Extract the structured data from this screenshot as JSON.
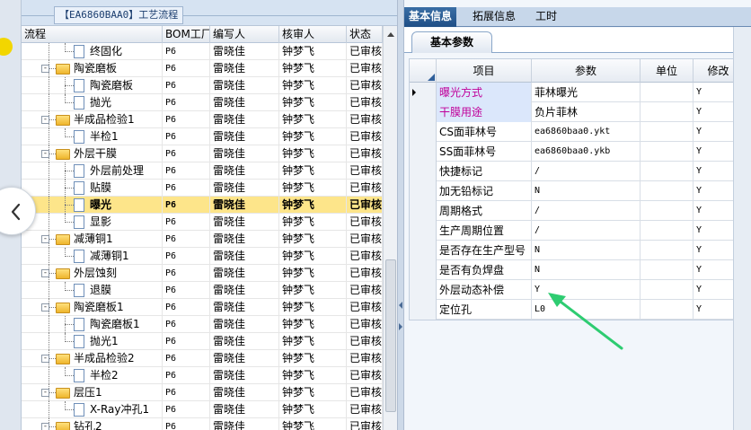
{
  "left_pane": {
    "title": "【EA6860BAA0】工艺流程",
    "columns": [
      "流程",
      "BOM工厂",
      "编写人",
      "核审人",
      "状态"
    ],
    "rows": [
      {
        "label": "终固化",
        "bom": "P6",
        "author": "雷晓佳",
        "reviewer": "钟梦飞",
        "status": "已审核",
        "level": 2,
        "type": "file",
        "selected": false
      },
      {
        "label": "陶瓷磨板",
        "bom": "P6",
        "author": "雷晓佳",
        "reviewer": "钟梦飞",
        "status": "已审核",
        "level": 1,
        "type": "folder",
        "selected": false
      },
      {
        "label": "陶瓷磨板",
        "bom": "P6",
        "author": "雷晓佳",
        "reviewer": "钟梦飞",
        "status": "已审核",
        "level": 2,
        "type": "file",
        "selected": false
      },
      {
        "label": "抛光",
        "bom": "P6",
        "author": "雷晓佳",
        "reviewer": "钟梦飞",
        "status": "已审核",
        "level": 2,
        "type": "file",
        "selected": false
      },
      {
        "label": "半成品检验1",
        "bom": "P6",
        "author": "雷晓佳",
        "reviewer": "钟梦飞",
        "status": "已审核",
        "level": 1,
        "type": "folder",
        "selected": false
      },
      {
        "label": "半检1",
        "bom": "P6",
        "author": "雷晓佳",
        "reviewer": "钟梦飞",
        "status": "已审核",
        "level": 2,
        "type": "file",
        "selected": false
      },
      {
        "label": "外层干膜",
        "bom": "P6",
        "author": "雷晓佳",
        "reviewer": "钟梦飞",
        "status": "已审核",
        "level": 1,
        "type": "folder",
        "selected": false
      },
      {
        "label": "外层前处理",
        "bom": "P6",
        "author": "雷晓佳",
        "reviewer": "钟梦飞",
        "status": "已审核",
        "level": 2,
        "type": "file",
        "selected": false
      },
      {
        "label": "贴膜",
        "bom": "P6",
        "author": "雷晓佳",
        "reviewer": "钟梦飞",
        "status": "已审核",
        "level": 2,
        "type": "file",
        "selected": false
      },
      {
        "label": "曝光",
        "bom": "P6",
        "author": "雷晓佳",
        "reviewer": "钟梦飞",
        "status": "已审核",
        "level": 2,
        "type": "file",
        "selected": true
      },
      {
        "label": "显影",
        "bom": "P6",
        "author": "雷晓佳",
        "reviewer": "钟梦飞",
        "status": "已审核",
        "level": 2,
        "type": "file",
        "selected": false
      },
      {
        "label": "减薄铜1",
        "bom": "P6",
        "author": "雷晓佳",
        "reviewer": "钟梦飞",
        "status": "已审核",
        "level": 1,
        "type": "folder",
        "selected": false
      },
      {
        "label": "减薄铜1",
        "bom": "P6",
        "author": "雷晓佳",
        "reviewer": "钟梦飞",
        "status": "已审核",
        "level": 2,
        "type": "file",
        "selected": false
      },
      {
        "label": "外层蚀刻",
        "bom": "P6",
        "author": "雷晓佳",
        "reviewer": "钟梦飞",
        "status": "已审核",
        "level": 1,
        "type": "folder",
        "selected": false
      },
      {
        "label": "退膜",
        "bom": "P6",
        "author": "雷晓佳",
        "reviewer": "钟梦飞",
        "status": "已审核",
        "level": 2,
        "type": "file",
        "selected": false
      },
      {
        "label": "陶瓷磨板1",
        "bom": "P6",
        "author": "雷晓佳",
        "reviewer": "钟梦飞",
        "status": "已审核",
        "level": 1,
        "type": "folder",
        "selected": false
      },
      {
        "label": "陶瓷磨板1",
        "bom": "P6",
        "author": "雷晓佳",
        "reviewer": "钟梦飞",
        "status": "已审核",
        "level": 2,
        "type": "file",
        "selected": false
      },
      {
        "label": "抛光1",
        "bom": "P6",
        "author": "雷晓佳",
        "reviewer": "钟梦飞",
        "status": "已审核",
        "level": 2,
        "type": "file",
        "selected": false
      },
      {
        "label": "半成品检验2",
        "bom": "P6",
        "author": "雷晓佳",
        "reviewer": "钟梦飞",
        "status": "已审核",
        "level": 1,
        "type": "folder",
        "selected": false
      },
      {
        "label": "半检2",
        "bom": "P6",
        "author": "雷晓佳",
        "reviewer": "钟梦飞",
        "status": "已审核",
        "level": 2,
        "type": "file",
        "selected": false
      },
      {
        "label": "层压1",
        "bom": "P6",
        "author": "雷晓佳",
        "reviewer": "钟梦飞",
        "status": "已审核",
        "level": 1,
        "type": "folder",
        "selected": false
      },
      {
        "label": "X-Ray冲孔1",
        "bom": "P6",
        "author": "雷晓佳",
        "reviewer": "钟梦飞",
        "status": "已审核",
        "level": 2,
        "type": "file",
        "selected": false
      },
      {
        "label": "钻孔2",
        "bom": "P6",
        "author": "雷晓佳",
        "reviewer": "钟梦飞",
        "status": "已审核",
        "level": 1,
        "type": "folder",
        "selected": false
      }
    ]
  },
  "right_pane": {
    "tabs": [
      {
        "label": "基本信息",
        "active": true
      },
      {
        "label": "拓展信息",
        "active": false
      },
      {
        "label": "工时",
        "active": false
      }
    ],
    "subtab": "基本参数",
    "columns": [
      "项目",
      "参数",
      "单位",
      "修改"
    ],
    "rows": [
      {
        "item": "曝光方式",
        "param": "菲林曝光",
        "unit": "",
        "modify": "Y",
        "highlight": true,
        "current": true
      },
      {
        "item": "干膜用途",
        "param": "负片菲林",
        "unit": "",
        "modify": "Y",
        "highlight": true,
        "current": false
      },
      {
        "item": "CS面菲林号",
        "param": "ea6860baa0.ykt",
        "unit": "",
        "modify": "Y",
        "highlight": false,
        "current": false
      },
      {
        "item": "SS面菲林号",
        "param": "ea6860baa0.ykb",
        "unit": "",
        "modify": "Y",
        "highlight": false,
        "current": false
      },
      {
        "item": "快捷标记",
        "param": "/",
        "unit": "",
        "modify": "Y",
        "highlight": false,
        "current": false
      },
      {
        "item": "加无铅标记",
        "param": "N",
        "unit": "",
        "modify": "Y",
        "highlight": false,
        "current": false
      },
      {
        "item": "周期格式",
        "param": "/",
        "unit": "",
        "modify": "Y",
        "highlight": false,
        "current": false
      },
      {
        "item": "生产周期位置",
        "param": "/",
        "unit": "",
        "modify": "Y",
        "highlight": false,
        "current": false
      },
      {
        "item": "是否存在生产型号",
        "param": "N",
        "unit": "",
        "modify": "Y",
        "highlight": false,
        "current": false
      },
      {
        "item": "是否有负焊盘",
        "param": "N",
        "unit": "",
        "modify": "Y",
        "highlight": false,
        "current": false
      },
      {
        "item": "外层动态补偿",
        "param": "Y",
        "unit": "",
        "modify": "Y",
        "highlight": false,
        "current": false
      },
      {
        "item": "定位孔",
        "param": "L0",
        "unit": "",
        "modify": "Y",
        "highlight": false,
        "current": false
      }
    ]
  },
  "icons": {
    "prev": "chevron-left-icon",
    "folder": "folder-icon",
    "file": "file-icon",
    "arrow": "green-arrow-annotation"
  },
  "colors": {
    "selected_row": "#fde58a",
    "highlight_text": "#c0009a",
    "highlight_bg": "#dbe7fb",
    "active_tab": "#1f4f86",
    "arrow": "#2ecc71"
  }
}
